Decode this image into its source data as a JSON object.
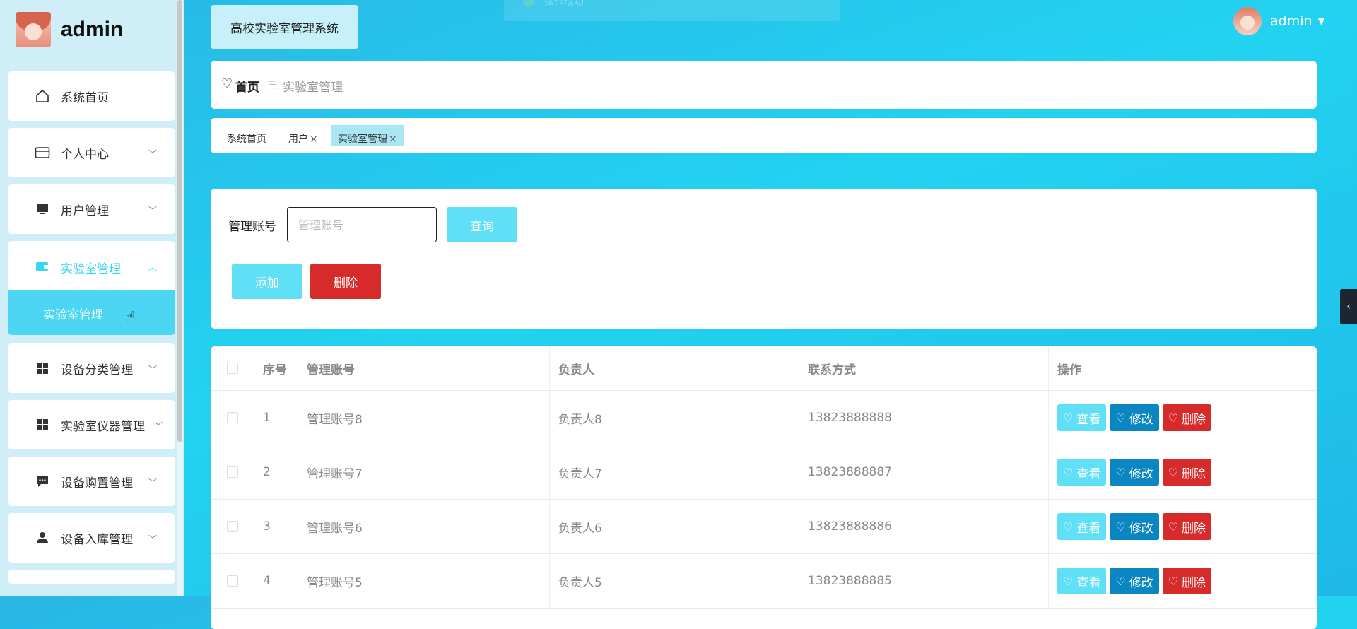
{
  "brand": {
    "name": "admin"
  },
  "sidebar": {
    "items": [
      {
        "label": "系统首页",
        "icon": "home-icon"
      },
      {
        "label": "个人中心",
        "icon": "card-icon"
      },
      {
        "label": "用户管理",
        "icon": "monitor-icon"
      },
      {
        "label": "实验室管理",
        "icon": "wallet-icon"
      },
      {
        "label": "设备分类管理",
        "icon": "grid-icon"
      },
      {
        "label": "实验室仪器管理",
        "icon": "grid-icon"
      },
      {
        "label": "设备购置管理",
        "icon": "chat-icon"
      },
      {
        "label": "设备入库管理",
        "icon": "user-icon"
      }
    ],
    "sub_items": [
      {
        "label": "实验室管理"
      }
    ]
  },
  "header": {
    "system_title": "高校实验室管理系统",
    "toast_text": "操作成功",
    "user": {
      "name": "admin"
    }
  },
  "breadcrumb": {
    "home": "首页",
    "separator": "三",
    "current": "实验室管理"
  },
  "tags": [
    {
      "label": "系统首页",
      "closable": false
    },
    {
      "label": "用户",
      "closable": true
    },
    {
      "label": "实验室管理",
      "closable": true
    }
  ],
  "tag_close": "×",
  "search": {
    "label": "管理账号",
    "placeholder": "管理账号",
    "value": "",
    "query_label": "查询",
    "add_label": "添加",
    "delete_label": "删除"
  },
  "table": {
    "columns": [
      "序号",
      "管理账号",
      "负责人",
      "联系方式",
      "操作"
    ],
    "rows": [
      {
        "index": "1",
        "account": "管理账号8",
        "owner": "负责人8",
        "phone": "13823888888"
      },
      {
        "index": "2",
        "account": "管理账号7",
        "owner": "负责人7",
        "phone": "13823888887"
      },
      {
        "index": "3",
        "account": "管理账号6",
        "owner": "负责人6",
        "phone": "13823888886"
      },
      {
        "index": "4",
        "account": "管理账号5",
        "owner": "负责人5",
        "phone": "13823888885"
      }
    ],
    "actions": {
      "view": "查看",
      "edit": "修改",
      "delete": "删除"
    }
  },
  "colors": {
    "accent": "#5fe0f7",
    "danger": "#d72a2a",
    "edit": "#0a87c3",
    "background": "#22d3f0",
    "sidebar": "#cfeef8"
  }
}
